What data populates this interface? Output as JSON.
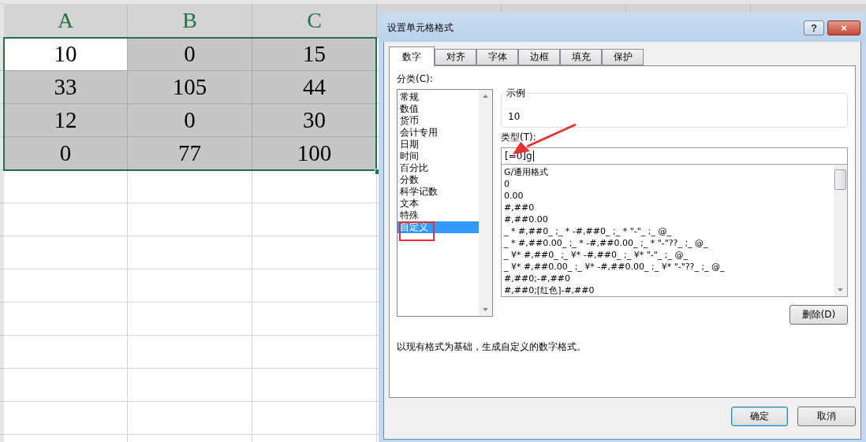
{
  "sheet": {
    "columns": [
      {
        "label": "A"
      },
      {
        "label": "B"
      },
      {
        "label": "C"
      }
    ],
    "rows": [
      [
        {
          "value": "10",
          "active": true
        },
        {
          "value": "0",
          "active": false
        },
        {
          "value": "15",
          "active": false
        }
      ],
      [
        {
          "value": "33",
          "active": false
        },
        {
          "value": "105",
          "active": false
        },
        {
          "value": "44",
          "active": false
        }
      ],
      [
        {
          "value": "12",
          "active": false
        },
        {
          "value": "0",
          "active": false
        },
        {
          "value": "30",
          "active": false
        }
      ],
      [
        {
          "value": "0",
          "active": false
        },
        {
          "value": "77",
          "active": false
        },
        {
          "value": "100",
          "active": false
        }
      ]
    ]
  },
  "dialog": {
    "title": "设置单元格格式",
    "help": "?",
    "close": "×",
    "tabs": [
      {
        "label": "数字",
        "selected": true
      },
      {
        "label": "对齐",
        "selected": false
      },
      {
        "label": "字体",
        "selected": false
      },
      {
        "label": "边框",
        "selected": false
      },
      {
        "label": "填充",
        "selected": false
      },
      {
        "label": "保护",
        "selected": false
      }
    ],
    "category_label": "分类(C):",
    "categories": [
      {
        "label": "常规",
        "selected": false
      },
      {
        "label": "数值",
        "selected": false
      },
      {
        "label": "货币",
        "selected": false
      },
      {
        "label": "会计专用",
        "selected": false
      },
      {
        "label": "日期",
        "selected": false
      },
      {
        "label": "时间",
        "selected": false
      },
      {
        "label": "百分比",
        "selected": false
      },
      {
        "label": "分数",
        "selected": false
      },
      {
        "label": "科学记数",
        "selected": false
      },
      {
        "label": "文本",
        "selected": false
      },
      {
        "label": "特殊",
        "selected": false
      },
      {
        "label": "自定义",
        "selected": true
      }
    ],
    "sample_label": "示例",
    "sample_value": "10",
    "type_label": "类型(T):",
    "type_value": "[=0]g",
    "formats": [
      "G/通用格式",
      "0",
      "0.00",
      "#,##0",
      "#,##0.00",
      "_ * #,##0_ ;_ * -#,##0_ ;_ * \"-\"_ ;_ @_",
      "_ * #,##0.00_ ;_ * -#,##0.00_ ;_ * \"-\"??_ ;_ @_",
      "_ ¥* #,##0_ ;_ ¥* -#,##0_ ;_ ¥* \"-\"_ ;_ @_",
      "_ ¥* #,##0.00_ ;_ ¥* -#,##0.00_ ;_ ¥* \"-\"??_ ;_ @_",
      "#,##0;-#,##0",
      "#,##0;[红色]-#,##0"
    ],
    "delete_button": "删除(D)",
    "description": "以现有格式为基础，生成自定义的数字格式。",
    "buttons": [
      {
        "label": "确定",
        "kind": "default"
      },
      {
        "label": "取消",
        "kind": "normal"
      }
    ]
  }
}
